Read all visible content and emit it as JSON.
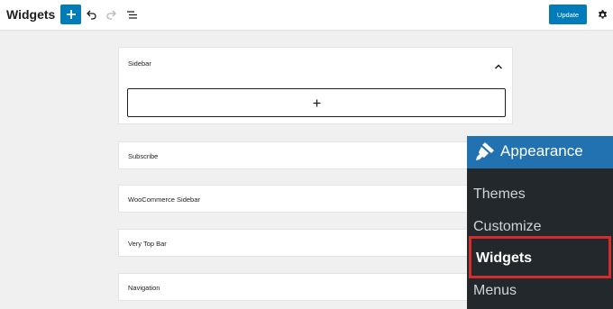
{
  "header": {
    "title": "Widgets",
    "add_icon": "plus-icon",
    "undo_icon": "undo-icon",
    "redo_icon": "redo-icon",
    "list_view_icon": "list-view-icon",
    "update_label": "Update",
    "settings_icon": "gear-icon"
  },
  "widget_areas": {
    "sidebar": {
      "title": "Sidebar",
      "toggle_icon": "chevron-up-icon",
      "appender_icon": "plus-icon"
    },
    "collapsed": [
      {
        "title": "Subscribe"
      },
      {
        "title": "WooCommerce Sidebar"
      },
      {
        "title": "Very Top Bar"
      },
      {
        "title": "Navigation"
      }
    ]
  },
  "admin_menu": {
    "heading": "Appearance",
    "heading_icon": "paintbrush-icon",
    "items": [
      "Themes",
      "Customize",
      "Widgets",
      "Menus"
    ],
    "active_item": "Widgets"
  },
  "colors": {
    "accent": "#007cba",
    "menu_bg": "#23282d",
    "menu_head_bg": "#2271b1",
    "highlight_border": "#d42b2b"
  }
}
